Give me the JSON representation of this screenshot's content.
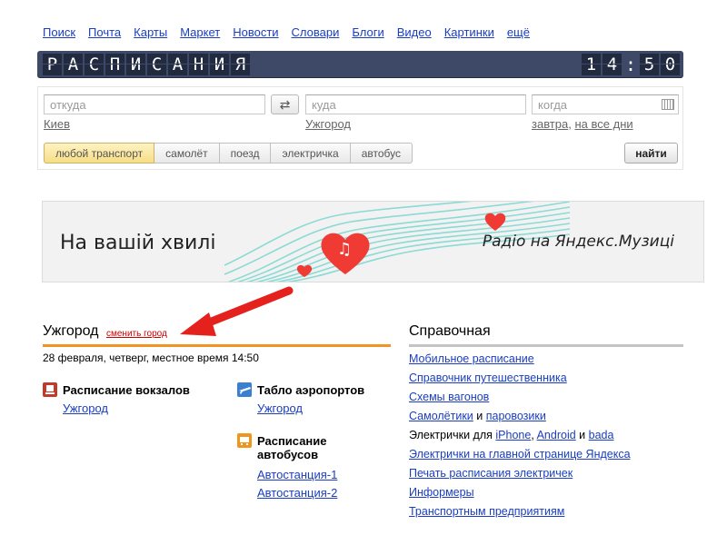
{
  "topnav": [
    "Поиск",
    "Почта",
    "Карты",
    "Маркет",
    "Новости",
    "Словари",
    "Блоги",
    "Видео",
    "Картинки",
    "ещё"
  ],
  "header": {
    "title_letters": [
      "Р",
      "А",
      "С",
      "П",
      "И",
      "С",
      "А",
      "Н",
      "И",
      "Я"
    ],
    "clock_hours": [
      "1",
      "4"
    ],
    "clock_minutes": [
      "5",
      "0"
    ],
    "clock_separator": ":"
  },
  "search": {
    "from_placeholder": "откуда",
    "to_placeholder": "куда",
    "date_placeholder": "когда",
    "swap_label": "⇄",
    "from_hint": "Киев",
    "to_hint": "Ужгород",
    "date_hint_1": "завтра",
    "date_hint_sep": ",",
    "date_hint_2": "на все дни",
    "transport": [
      "любой транспорт",
      "самолёт",
      "поезд",
      "электричка",
      "автобус"
    ],
    "find_label": "найти"
  },
  "banner": {
    "left_text": "На вашій хвилі",
    "right_text": "Радіо на Яндекс.Музиці"
  },
  "city": {
    "name": "Ужгород",
    "change_label": "сменить город",
    "dateline": "28 февраля, четверг, местное время 14:50"
  },
  "sections": {
    "rail": {
      "title": "Расписание вокзалов",
      "links": [
        "Ужгород"
      ]
    },
    "air": {
      "title": "Табло аэропортов",
      "links": [
        "Ужгород"
      ]
    },
    "bus": {
      "title_1": "Расписание",
      "title_2": "автобусов",
      "links": [
        "Автостанция-1",
        "Автостанция-2"
      ]
    }
  },
  "reference": {
    "title": "Справочная",
    "items": {
      "mobile": "Мобильное расписание",
      "traveler": "Справочник путешественника",
      "cars": "Схемы вагонов",
      "planes": "Самолётики",
      "and1": "и",
      "ships": "паровозики",
      "trains_for": "Электрички для",
      "iphone": "iPhone",
      "comma": ",",
      "android": "Android",
      "and2": "и",
      "bada": "bada",
      "trains_main": "Электрички на главной странице Яндекса",
      "print": "Печать расписания электричек",
      "informers": "Информеры",
      "companies": "Транспортным предприятиям"
    }
  },
  "colors": {
    "accent_orange": "#f39422",
    "link_blue": "#1a3dc1",
    "header_bg": "#3e4867",
    "arrow_red": "#e5211d"
  }
}
